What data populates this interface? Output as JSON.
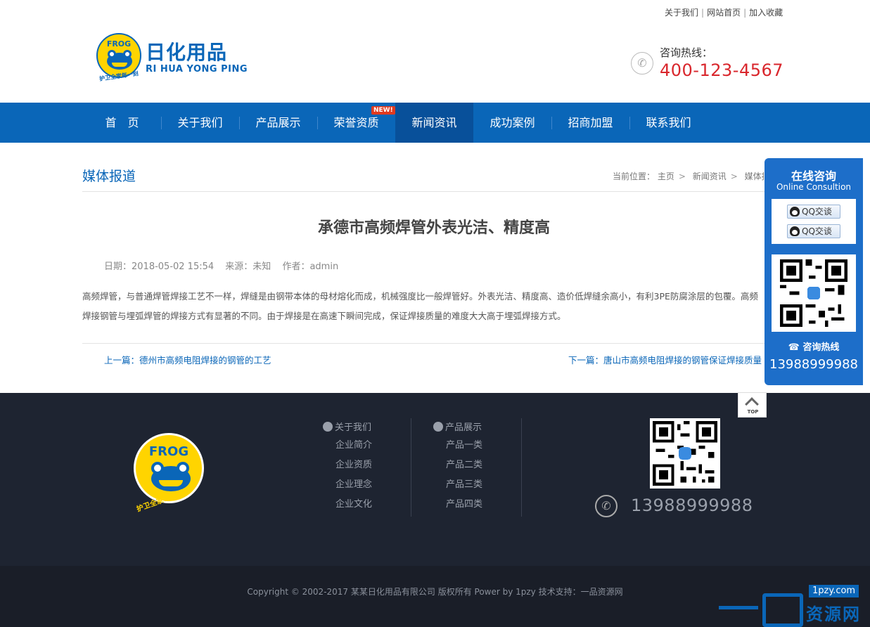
{
  "top_links": {
    "about": "关于我们",
    "home": "网站首页",
    "favorite": "加入收藏"
  },
  "logo": {
    "badge": "FROG",
    "name_cn": "日化用品",
    "name_en": "RI HUA YONG PING",
    "slogan": "护卫全家每一刻"
  },
  "header_hotline": {
    "label": "咨询热线：",
    "number": "400-123-4567"
  },
  "nav": {
    "items": [
      "首　页",
      "关于我们",
      "产品展示",
      "荣誉资质",
      "新闻资讯",
      "成功案例",
      "招商加盟",
      "联系我们"
    ],
    "active_index": 4,
    "new_badge": "NEW!"
  },
  "section": {
    "title": "媒体报道",
    "breadcrumb_prefix": "当前位置：",
    "breadcrumb": [
      "主页",
      "新闻资讯",
      "媒体报道"
    ]
  },
  "article": {
    "title": "承德市高频焊管外表光洁、精度高",
    "date": "日期：2018-05-02 15:54",
    "source": "来源：未知",
    "author": "作者：admin",
    "body": [
      "高频焊管，与普通焊管焊接工艺不一样，焊缝是由钢带本体的母材熔化而成，机械强度比一般焊管好。外表光洁、精度高、造价低焊缝余高小，有利3PE防腐涂层的包覆。高频",
      "焊接钢管与埋弧焊管的焊接方式有显著的不同。由于焊接是在高速下瞬间完成，保证焊接质量的难度大大高于埋弧焊接方式。"
    ],
    "prev": "上一篇：德州市高频电阻焊接的钢管的工艺",
    "next": "下一篇：唐山市高频电阻焊接的钢管保证焊接质量"
  },
  "footer": {
    "col1": {
      "head": "关于我们",
      "items": [
        "企业简介",
        "企业资质",
        "企业理念",
        "企业文化"
      ]
    },
    "col2": {
      "head": "产品展示",
      "items": [
        "产品一类",
        "产品二类",
        "产品三类",
        "产品四类"
      ]
    },
    "phone": "13988999988",
    "copyright": "Copyright © 2002-2017 某某日化用品有限公司 版权所有 Power by 1pzy 技术支持：一品资源网"
  },
  "float_panel": {
    "title": "在线咨询",
    "subtitle": "Online Consultion",
    "qq_buttons": [
      "QQ交谈",
      "QQ交谈"
    ],
    "hotline_label": "咨询热线",
    "hotline": "13988999988"
  },
  "totop_label": "TOP",
  "watermark": {
    "site": "1pzy.com",
    "text": "资源网"
  },
  "colors": {
    "brand_blue": "#0a66b8",
    "hotline_red": "#d9262c",
    "footer_bg": "#1e2431",
    "logo_yellow": "#ffd400"
  }
}
